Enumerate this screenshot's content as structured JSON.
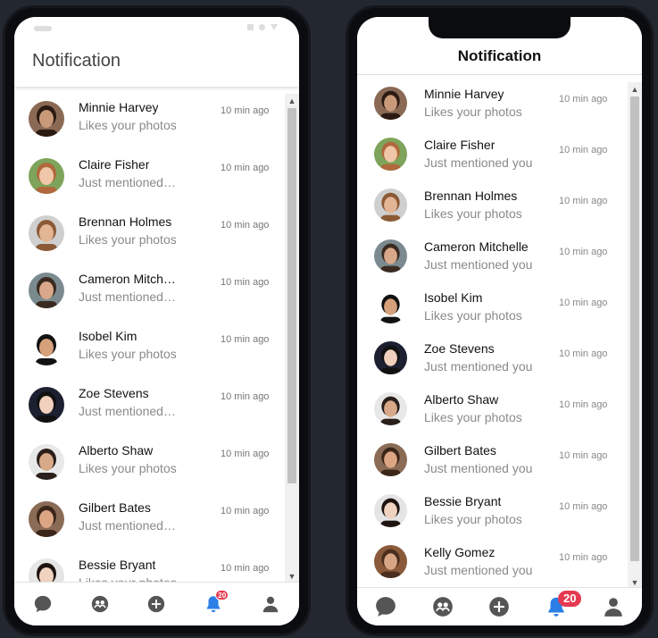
{
  "left_phone": {
    "title": "Notification",
    "items": [
      {
        "name": "Minnie Harvey",
        "message": "Likes your photos",
        "time": "10 min ago",
        "skin": "#c89a7a",
        "hair": "#2b1a12",
        "bg": "#8a6a55"
      },
      {
        "name": "Claire Fisher",
        "message": "Just mentioned you",
        "time": "10 min ago",
        "skin": "#f0c7a8",
        "hair": "#b0683c",
        "bg": "#7da45a"
      },
      {
        "name": "Brennan Holmes",
        "message": "Likes your photos",
        "time": "10 min ago",
        "skin": "#e2b594",
        "hair": "#8b5a35",
        "bg": "#cfcfcf"
      },
      {
        "name": "Cameron Mitchelle",
        "message": "Just mentioned you",
        "time": "10 min ago",
        "skin": "#d9a88b",
        "hair": "#3a2a20",
        "bg": "#7b8a8f"
      },
      {
        "name": "Isobel Kim",
        "message": "Likes your photos",
        "time": "10 min ago",
        "skin": "#d6a07a",
        "hair": "#111111",
        "bg": "#ffffff"
      },
      {
        "name": "Zoe Stevens",
        "message": "Just mentioned you",
        "time": "10 min ago",
        "skin": "#f1d0bd",
        "hair": "#111111",
        "bg": "#1c2030"
      },
      {
        "name": "Alberto Shaw",
        "message": "Likes your photos",
        "time": "10 min ago",
        "skin": "#d8a989",
        "hair": "#2a1f1a",
        "bg": "#e8e8e8"
      },
      {
        "name": "Gilbert Bates",
        "message": "Just mentioned you",
        "time": "10 min ago",
        "skin": "#dca583",
        "hair": "#3b2619",
        "bg": "#8a6b56"
      },
      {
        "name": "Bessie Bryant",
        "message": "Likes your photos",
        "time": "10 min ago",
        "skin": "#f0d2c0",
        "hair": "#1e140f",
        "bg": "#e5e5e5"
      }
    ],
    "nav": {
      "badge": "20"
    }
  },
  "right_phone": {
    "title": "Notification",
    "items": [
      {
        "name": "Minnie Harvey",
        "message": "Likes your photos",
        "time": "10 min ago",
        "skin": "#c89a7a",
        "hair": "#2b1a12",
        "bg": "#8a6a55"
      },
      {
        "name": "Claire Fisher",
        "message": "Just mentioned you",
        "time": "10 min ago",
        "skin": "#f0c7a8",
        "hair": "#b0683c",
        "bg": "#7da45a"
      },
      {
        "name": "Brennan Holmes",
        "message": "Likes your photos",
        "time": "10 min ago",
        "skin": "#e2b594",
        "hair": "#8b5a35",
        "bg": "#cfcfcf"
      },
      {
        "name": "Cameron Mitchelle",
        "message": "Just mentioned you",
        "time": "10 min ago",
        "skin": "#d9a88b",
        "hair": "#3a2a20",
        "bg": "#7b8a8f"
      },
      {
        "name": "Isobel Kim",
        "message": "Likes your photos",
        "time": "10 min ago",
        "skin": "#d6a07a",
        "hair": "#111111",
        "bg": "#ffffff"
      },
      {
        "name": "Zoe Stevens",
        "message": "Just mentioned you",
        "time": "10 min ago",
        "skin": "#f1d0bd",
        "hair": "#111111",
        "bg": "#1c2030"
      },
      {
        "name": "Alberto Shaw",
        "message": "Likes your photos",
        "time": "10 min ago",
        "skin": "#d8a989",
        "hair": "#2a1f1a",
        "bg": "#e8e8e8"
      },
      {
        "name": "Gilbert Bates",
        "message": "Just mentioned you",
        "time": "10 min ago",
        "skin": "#dca583",
        "hair": "#3b2619",
        "bg": "#8a6b56"
      },
      {
        "name": "Bessie Bryant",
        "message": "Likes your photos",
        "time": "10 min ago",
        "skin": "#f0d2c0",
        "hair": "#1e140f",
        "bg": "#e5e5e5"
      },
      {
        "name": "Kelly Gomez",
        "message": "Just mentioned you",
        "time": "10 min ago",
        "skin": "#d8a585",
        "hair": "#4a2e1e",
        "bg": "#8a5a3a"
      }
    ],
    "nav": {
      "badge": "20"
    }
  },
  "colors": {
    "page_bg": "#23272f",
    "device": "#0b0c0f",
    "icon_gray": "#555555",
    "icon_active": "#2b7fe6",
    "badge": "#e53950"
  },
  "icons": [
    "chat-icon",
    "group-icon",
    "add-icon",
    "bell-icon",
    "user-icon"
  ]
}
